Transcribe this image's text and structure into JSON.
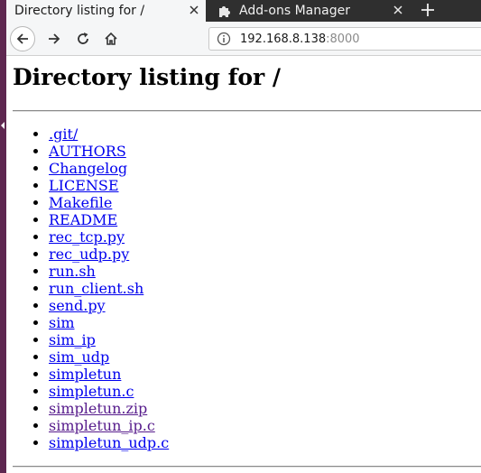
{
  "tabs": [
    {
      "title": "Directory listing for /",
      "active": true
    },
    {
      "title": "Add-ons Manager",
      "active": false
    }
  ],
  "url": {
    "host": "192.168.8.138",
    "port": ":8000"
  },
  "page": {
    "heading": "Directory listing for /",
    "entries": [
      {
        "name": ".git/",
        "visited": false
      },
      {
        "name": "AUTHORS",
        "visited": false
      },
      {
        "name": "Changelog",
        "visited": false
      },
      {
        "name": "LICENSE",
        "visited": false
      },
      {
        "name": "Makefile",
        "visited": false
      },
      {
        "name": "README",
        "visited": false
      },
      {
        "name": "rec_tcp.py",
        "visited": false
      },
      {
        "name": "rec_udp.py",
        "visited": false
      },
      {
        "name": "run.sh",
        "visited": false
      },
      {
        "name": "run_client.sh",
        "visited": false
      },
      {
        "name": "send.py",
        "visited": false
      },
      {
        "name": "sim",
        "visited": false
      },
      {
        "name": "sim_ip",
        "visited": false
      },
      {
        "name": "sim_udp",
        "visited": false
      },
      {
        "name": "simpletun",
        "visited": false
      },
      {
        "name": "simpletun.c",
        "visited": false
      },
      {
        "name": "simpletun.zip",
        "visited": true
      },
      {
        "name": "simpletun_ip.c",
        "visited": true
      },
      {
        "name": "simpletun_udp.c",
        "visited": false
      }
    ]
  },
  "icons": {
    "tab_close": "close-icon",
    "addons": "puzzle-icon",
    "new_tab": "plus-icon",
    "back": "back-arrow-icon",
    "forward": "forward-arrow-icon",
    "reload": "reload-icon",
    "home": "home-icon",
    "site_info": "info-icon"
  },
  "colors": {
    "link": "#0000ee",
    "visited_link": "#551a8b",
    "tabbar": "#2f2f2f",
    "desktop_strip": "#5e2750"
  }
}
